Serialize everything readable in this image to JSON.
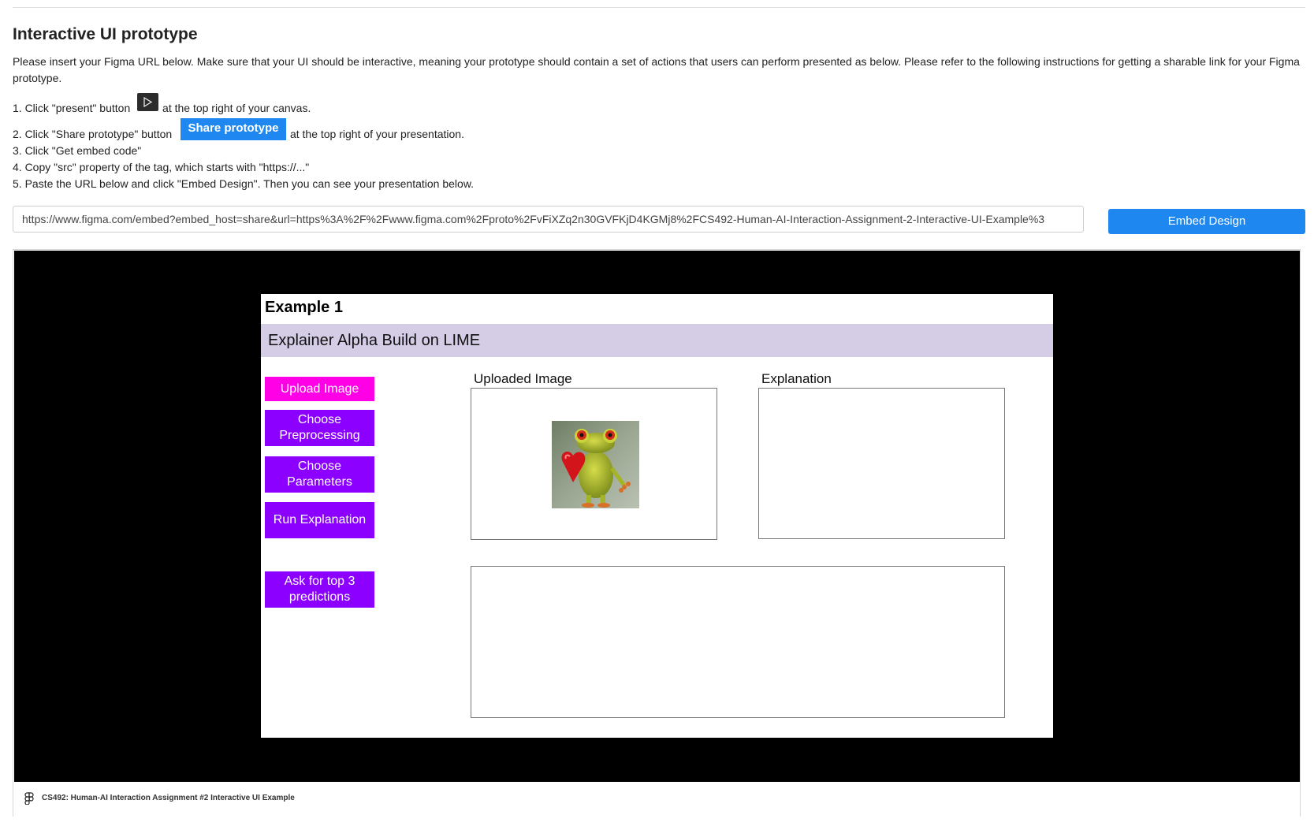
{
  "page": {
    "title": "Interactive UI prototype",
    "intro": "Please insert your Figma URL below. Make sure that your UI should be interactive, meaning your prototype should contain a set of actions that users can perform presented as below. Please refer to the following instructions for getting a sharable link for your Figma prototype."
  },
  "steps": {
    "s1_before": "1. Click \"present\" button",
    "s1_after": "at the top right of your canvas.",
    "s2_before": "2. Click \"Share prototype\" button",
    "s2_after": "at the top right of your presentation.",
    "s3": "3. Click \"Get embed code\"",
    "s4": "4. Copy \"src\" property of the tag, which starts with \"https://...\"",
    "s5": "5. Paste the URL below and click \"Embed Design\". Then you can see your presentation below.",
    "share_button_label": "Share prototype",
    "play_icon": "play-icon"
  },
  "embed": {
    "url_value": "https://www.figma.com/embed?embed_host=share&url=https%3A%2F%2Fwww.figma.com%2Fproto%2FvFiXZq2n30GVFKjD4KGMj8%2FCS492-Human-AI-Interaction-Assignment-2-Interactive-UI-Example%3",
    "button_label": "Embed Design",
    "accent_color": "#1e88f0"
  },
  "prototype": {
    "example_title": "Example 1",
    "banner": "Explainer Alpha Build on LIME",
    "buttons": {
      "upload": "Upload Image",
      "preprocessing": "Choose Preprocessing",
      "parameters": "Choose Parameters",
      "run": "Run Explanation",
      "top3": "Ask for top 3 predictions"
    },
    "labels": {
      "uploaded_image": "Uploaded Image",
      "explanation": "Explanation"
    },
    "colors": {
      "upload_button": "#ff00e6",
      "action_button": "#8c00ff",
      "banner": "#d5cce6"
    }
  },
  "footer": {
    "file_name": "CS492: Human-AI Interaction Assignment #2 Interactive UI Example",
    "logo_icon": "figma-logo-icon"
  }
}
